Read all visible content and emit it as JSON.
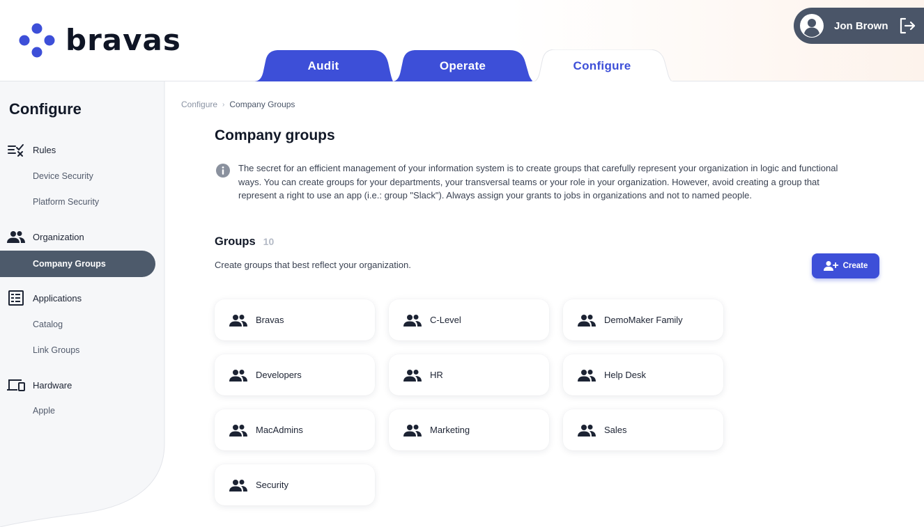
{
  "brand": {
    "name": "bravas",
    "accent": "#3d4fd8"
  },
  "tabs": [
    {
      "label": "Audit",
      "active": false
    },
    {
      "label": "Operate",
      "active": false
    },
    {
      "label": "Configure",
      "active": true
    }
  ],
  "user": {
    "name": "Jon Brown"
  },
  "sidebar": {
    "title": "Configure",
    "sections": [
      {
        "label": "Rules",
        "icon": "rules-icon",
        "items": [
          "Device Security",
          "Platform Security"
        ]
      },
      {
        "label": "Organization",
        "icon": "people-icon",
        "items": [
          "Company Groups"
        ]
      },
      {
        "label": "Applications",
        "icon": "list-icon",
        "items": [
          "Catalog",
          "Link Groups"
        ]
      },
      {
        "label": "Hardware",
        "icon": "devices-icon",
        "items": [
          "Apple"
        ]
      }
    ],
    "active_item": "Company Groups"
  },
  "breadcrumb": {
    "parent": "Configure",
    "current": "Company Groups"
  },
  "main": {
    "title": "Company groups",
    "info": "The secret for an efficient management of your information system is to create groups that carefully represent your organization in logic and functional ways. You can create groups for your departments, your transversal teams or your role in your organization. However, avoid creating a group that represent a right to use an app (i.e.: group \"Slack\"). Always assign your grants to jobs in organizations and not to named people.",
    "groups_title": "Groups",
    "groups_count": "10",
    "groups_subtitle": "Create groups that best reflect your organization.",
    "create_label": "Create",
    "groups": [
      "Bravas",
      "C-Level",
      "DemoMaker Family",
      "Developers",
      "HR",
      "Help Desk",
      "MacAdmins",
      "Marketing",
      "Sales",
      "Security"
    ]
  }
}
